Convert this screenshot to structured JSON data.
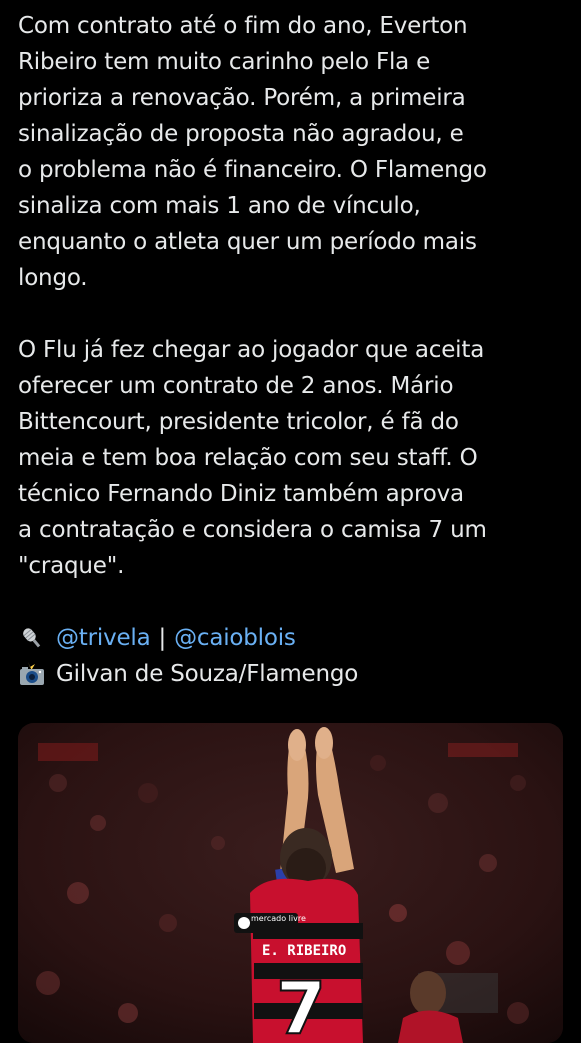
{
  "tweet": {
    "paragraph_1": "Com contrato até o fim do ano, Everton\nRibeiro tem muito carinho pelo Fla e\nprioriza a renovação. Porém, a primeira\nsinalização de proposta não agradou, e\no problema não é financeiro. O Flamengo\nsinaliza com mais 1 ano de vínculo,\nenquanto o atleta quer um período mais\nlongo.",
    "paragraph_2": "O Flu já fez chegar ao jogador que aceita\noferecer um contrato de 2 anos. Mário\nBittencourt, presidente tricolor, é fã do\nmeia e tem boa relação com seu staff. O\ntécnico Fernando Diniz também aprova\na contratação e considera o camisa 7 um\n\"craque\".",
    "credits": {
      "mention_1": "@trivela",
      "separator": "|",
      "mention_2": "@caioblois",
      "photo_credit": "Gilvan de Souza/Flamengo"
    },
    "media": {
      "jersey_name": "E. RIBEIRO",
      "jersey_sponsor": "mercado livre",
      "jersey_number": "7"
    }
  },
  "colors": {
    "background": "#000000",
    "text": "#e7e9ea",
    "link": "#6ab0f3",
    "jersey_red": "#c8102e",
    "jersey_black": "#111111"
  },
  "icons": {
    "mention_icon": "microphone-icon",
    "photo_icon": "camera-flash-icon"
  }
}
